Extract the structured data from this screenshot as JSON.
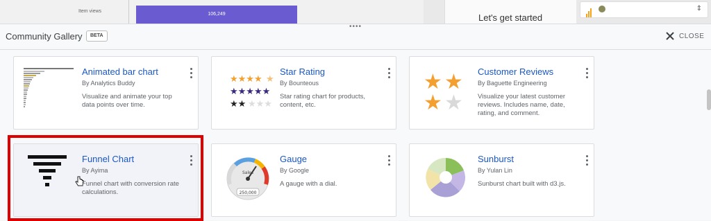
{
  "background": {
    "item_views_label": "Item views",
    "item_views_value": "106,249",
    "lets_get_started": "Let's get started"
  },
  "gallery": {
    "title": "Community Gallery",
    "badge": "BETA",
    "close_label": "CLOSE",
    "cards": [
      {
        "title": "Animated bar chart",
        "by": "By Analytics Buddy",
        "desc": "Visualize and animate your top data points over time.",
        "icon": "animated-bar-chart-thumbnail"
      },
      {
        "title": "Star Rating",
        "by": "By Bounteous",
        "desc": "Star rating chart for products, content, etc.",
        "icon": "star-rating-thumbnail"
      },
      {
        "title": "Customer Reviews",
        "by": "By Baguette Engineering",
        "desc": "Visualize your latest customer reviews. Includes name, date, rating, and comment.",
        "icon": "customer-reviews-thumbnail"
      },
      {
        "title": "Funnel Chart",
        "by": "By Ayima",
        "desc": "Funnel chart with conversion rate calculations.",
        "icon": "funnel-chart-thumbnail"
      },
      {
        "title": "Gauge",
        "by": "By Google",
        "desc": "A gauge with a dial.",
        "icon": "gauge-thumbnail",
        "gauge_label": "Sales",
        "gauge_value": "250,000"
      },
      {
        "title": "Sunburst",
        "by": "By Yulan Lin",
        "desc": "Sunburst chart built with d3.js.",
        "icon": "sunburst-thumbnail"
      }
    ]
  },
  "colors": {
    "accent": "#1a57c6",
    "selection_outline": "#e00000",
    "star": "#f4a030",
    "bar_purple": "#6a5bd1"
  }
}
